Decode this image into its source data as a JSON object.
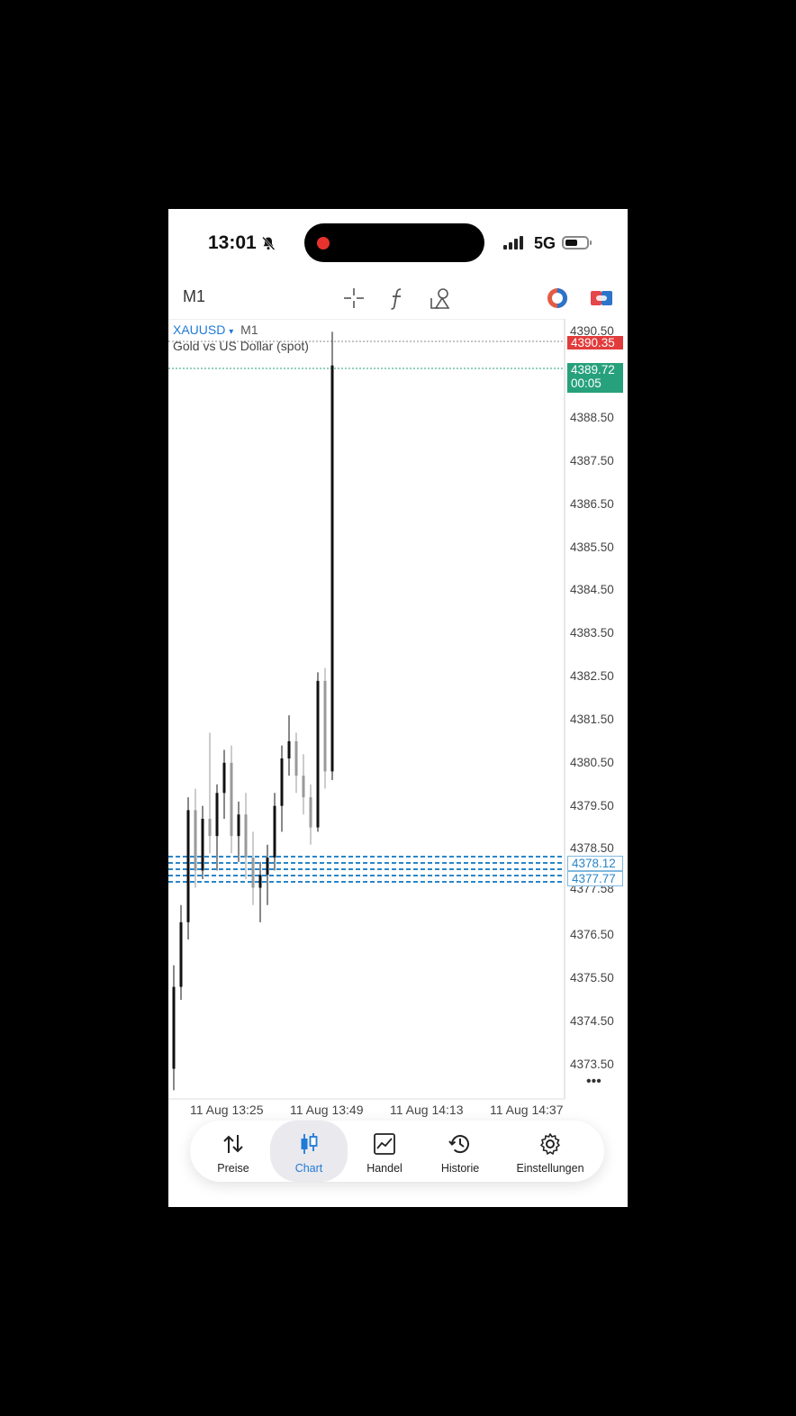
{
  "status_bar": {
    "time": "13:01",
    "network": "5G"
  },
  "toolbar": {
    "timeframe": "M1"
  },
  "chart": {
    "symbol": "XAUUSD",
    "symbol_arrow": "▾",
    "timeframe": "M1",
    "description": "Gold vs US Dollar (spot)",
    "ask_price": "4390.35",
    "bid_price": "4389.72",
    "countdown": "00:05",
    "order_price_1": "4378.12",
    "order_price_2": "4377.77",
    "more": "•••"
  },
  "chart_data": {
    "type": "candlestick",
    "y_ticks": [
      "4390.50",
      "4388.50",
      "4387.50",
      "4386.50",
      "4385.50",
      "4384.50",
      "4383.50",
      "4382.50",
      "4381.50",
      "4380.50",
      "4379.50",
      "4378.50",
      "4377.58",
      "4376.50",
      "4375.50",
      "4374.50",
      "4373.50"
    ],
    "x_ticks": [
      "11 Aug 13:25",
      "11 Aug 13:49",
      "11 Aug 14:13",
      "11 Aug 14:37"
    ],
    "ylim": [
      4372.7,
      4390.8
    ],
    "candles": [
      {
        "o": 4373.4,
        "h": 4375.8,
        "l": 4372.9,
        "c": 4375.3,
        "up": true
      },
      {
        "o": 4375.3,
        "h": 4377.2,
        "l": 4375.0,
        "c": 4376.8,
        "up": true
      },
      {
        "o": 4376.8,
        "h": 4379.7,
        "l": 4376.4,
        "c": 4379.4,
        "up": true
      },
      {
        "o": 4379.4,
        "h": 4379.9,
        "l": 4377.6,
        "c": 4378.0,
        "up": false
      },
      {
        "o": 4378.0,
        "h": 4379.5,
        "l": 4377.8,
        "c": 4379.2,
        "up": true
      },
      {
        "o": 4379.2,
        "h": 4381.2,
        "l": 4378.4,
        "c": 4378.8,
        "up": false
      },
      {
        "o": 4378.8,
        "h": 4380.0,
        "l": 4378.0,
        "c": 4379.8,
        "up": true
      },
      {
        "o": 4379.8,
        "h": 4380.8,
        "l": 4379.2,
        "c": 4380.5,
        "up": true
      },
      {
        "o": 4380.5,
        "h": 4380.9,
        "l": 4378.4,
        "c": 4378.8,
        "up": false
      },
      {
        "o": 4378.8,
        "h": 4379.6,
        "l": 4378.2,
        "c": 4379.3,
        "up": true
      },
      {
        "o": 4379.3,
        "h": 4379.8,
        "l": 4377.8,
        "c": 4378.3,
        "up": false
      },
      {
        "o": 4378.3,
        "h": 4378.9,
        "l": 4377.2,
        "c": 4377.6,
        "up": false
      },
      {
        "o": 4377.6,
        "h": 4378.2,
        "l": 4376.8,
        "c": 4377.9,
        "up": true
      },
      {
        "o": 4377.9,
        "h": 4378.6,
        "l": 4377.2,
        "c": 4378.3,
        "up": true
      },
      {
        "o": 4378.3,
        "h": 4379.8,
        "l": 4378.0,
        "c": 4379.5,
        "up": true
      },
      {
        "o": 4379.5,
        "h": 4380.9,
        "l": 4378.9,
        "c": 4380.6,
        "up": true
      },
      {
        "o": 4380.6,
        "h": 4381.6,
        "l": 4380.2,
        "c": 4381.0,
        "up": true
      },
      {
        "o": 4381.0,
        "h": 4381.2,
        "l": 4379.8,
        "c": 4380.2,
        "up": false
      },
      {
        "o": 4380.2,
        "h": 4380.7,
        "l": 4379.3,
        "c": 4379.7,
        "up": false
      },
      {
        "o": 4379.7,
        "h": 4380.0,
        "l": 4378.6,
        "c": 4379.0,
        "up": false
      },
      {
        "o": 4379.0,
        "h": 4382.6,
        "l": 4378.9,
        "c": 4382.4,
        "up": true
      },
      {
        "o": 4382.4,
        "h": 4382.7,
        "l": 4379.9,
        "c": 4380.3,
        "up": false
      },
      {
        "o": 4380.3,
        "h": 4390.5,
        "l": 4380.1,
        "c": 4389.72,
        "up": true
      }
    ]
  },
  "tabs": [
    {
      "label": "Preise",
      "icon": "arrows-updown-icon"
    },
    {
      "label": "Chart",
      "icon": "candlestick-icon"
    },
    {
      "label": "Handel",
      "icon": "trade-chart-icon"
    },
    {
      "label": "Historie",
      "icon": "history-icon"
    },
    {
      "label": "Einstellungen",
      "icon": "gear-icon"
    }
  ],
  "colors": {
    "accent": "#1f7ad6",
    "ask": "#e23b3b",
    "bid": "#26a17b",
    "order_lines": "#2a86c8"
  }
}
